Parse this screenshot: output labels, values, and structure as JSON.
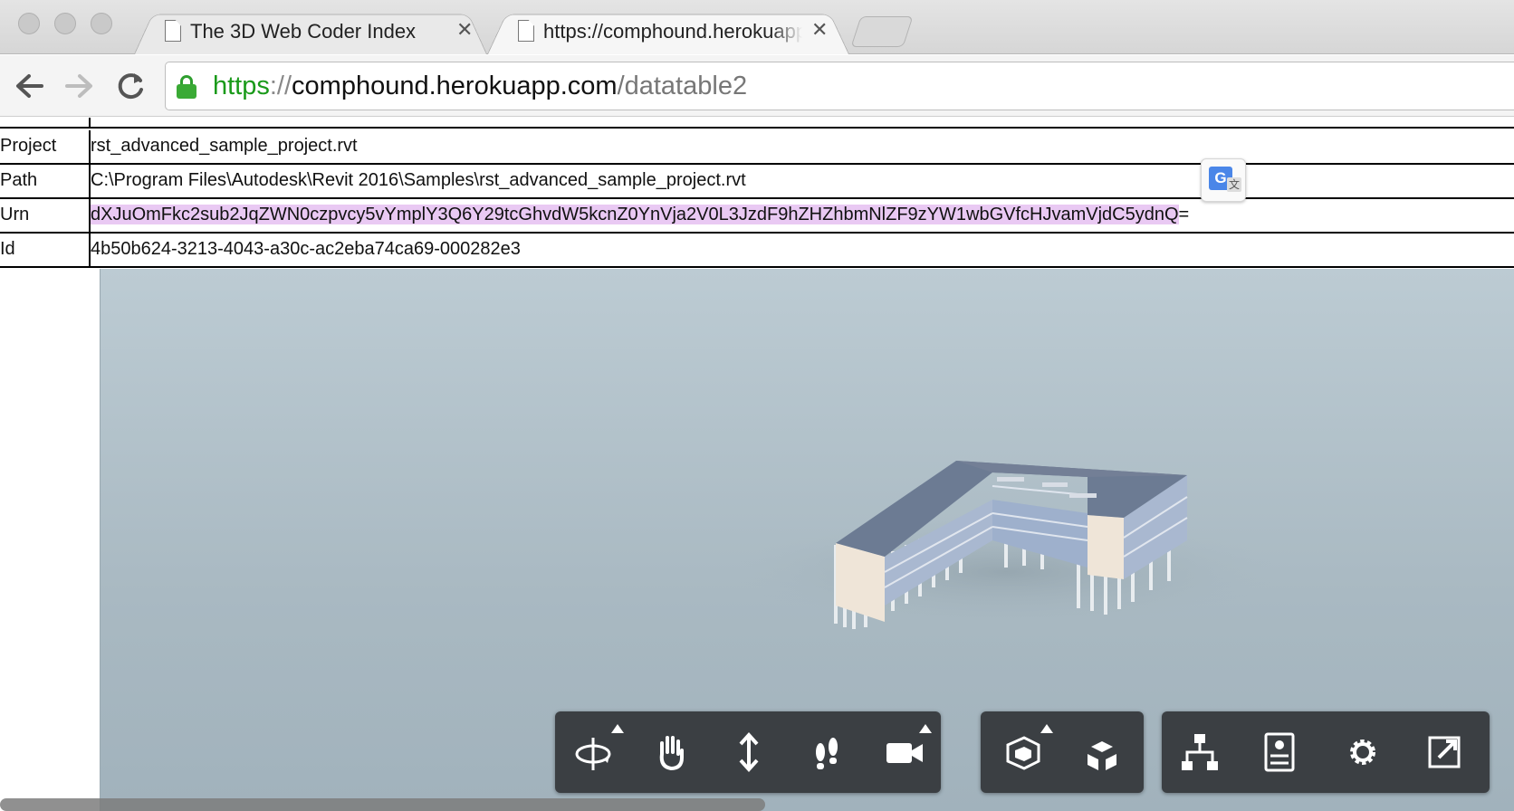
{
  "browser": {
    "tabs": [
      {
        "title": "The 3D Web Coder Index",
        "active": false
      },
      {
        "title": "https://comphound.herokuapp.com/datatable2",
        "active": true
      }
    ],
    "url": {
      "scheme": "https",
      "separator": "://",
      "host": "comphound.herokuapp.com",
      "path": "/datatable2"
    }
  },
  "table": {
    "rows": [
      {
        "key": "Project",
        "value": "rst_advanced_sample_project.rvt"
      },
      {
        "key": "Path",
        "value": "C:\\Program Files\\Autodesk\\Revit 2016\\Samples\\rst_advanced_sample_project.rvt"
      },
      {
        "key": "Urn",
        "value_highlighted": "dXJuOmFkc2sub2JqZWN0czpvcy5vYmplY3Q6Y29tcGhvdW5kcnZ0YnVja2V0L3JzdF9hZHZhbmNlZF9zYW1wbGVfcHJvamVjdC5ydnQ",
        "value_rest": "="
      },
      {
        "key": "Id",
        "value": "4b50b624-3213-4043-a30c-ac2eba74ca69-000282e3"
      }
    ]
  },
  "viewer": {
    "toolbar_groups": [
      {
        "tools": [
          "orbit-icon",
          "pan-icon",
          "zoom-icon",
          "walk-icon",
          "camera-icon"
        ]
      },
      {
        "tools": [
          "section-icon",
          "model-explode-icon"
        ]
      },
      {
        "tools": [
          "model-browser-icon",
          "properties-icon",
          "settings-icon",
          "fullscreen-icon"
        ]
      }
    ]
  },
  "colors": {
    "url_scheme": "#1a9a1a",
    "highlight": "#e9c9f3",
    "viewer_toolbar": "#3b3f43"
  }
}
